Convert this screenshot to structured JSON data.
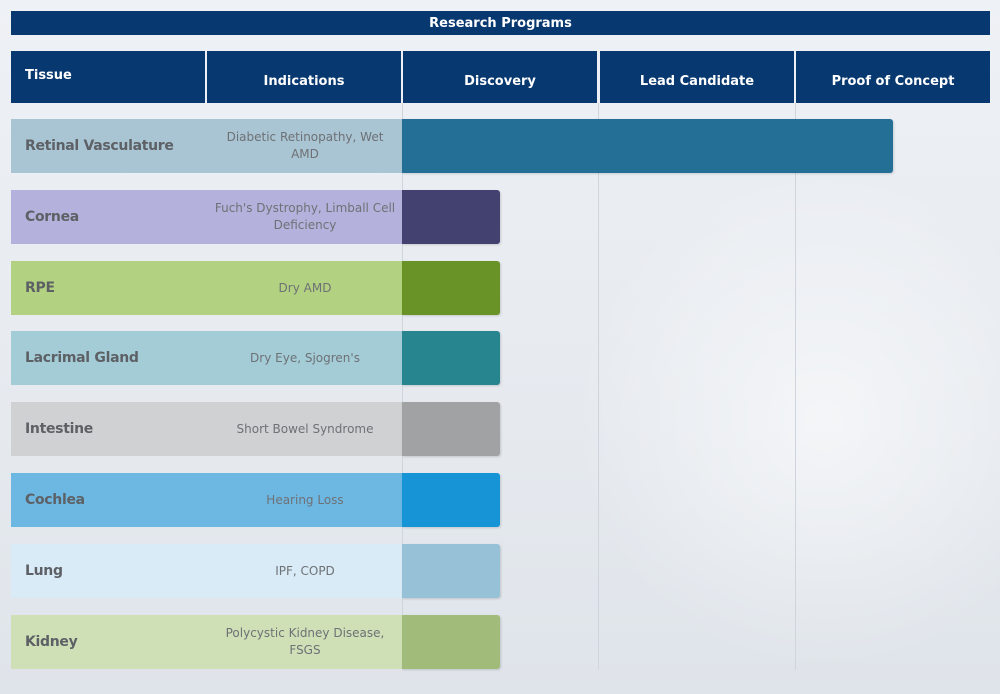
{
  "title": "Research Programs",
  "columns": [
    "Tissue",
    "Indications",
    "Discovery",
    "Lead Candidate",
    "Proof of Concept"
  ],
  "chart_data": {
    "type": "bar",
    "orientation": "horizontal",
    "title": "Research Programs",
    "stages": [
      "Discovery",
      "Lead Candidate",
      "Proof of Concept"
    ],
    "xlim": [
      0,
      3
    ],
    "rows": [
      {
        "tissue": "Retinal Vasculature",
        "indication": "Diabetic Retinopathy, Wet AMD",
        "progress": 2.5,
        "label_color": "#a9c4d2",
        "bar_color": "#236f95"
      },
      {
        "tissue": "Cornea",
        "indication": "Fuch's Dystrophy, Limball Cell Deficiency",
        "progress": 0.5,
        "label_color": "#b4b2dc",
        "bar_color": "#434170"
      },
      {
        "tissue": "RPE",
        "indication": "Dry AMD",
        "progress": 0.5,
        "label_color": "#b2d281",
        "bar_color": "#6a9327"
      },
      {
        "tissue": "Lacrimal Gland",
        "indication": "Dry Eye, Sjogren's",
        "progress": 0.5,
        "label_color": "#a4ccd7",
        "bar_color": "#27858f"
      },
      {
        "tissue": "Intestine",
        "indication": "Short Bowel Syndrome",
        "progress": 0.5,
        "label_color": "#d0d1d3",
        "bar_color": "#a1a2a4"
      },
      {
        "tissue": "Cochlea",
        "indication": "Hearing Loss",
        "progress": 0.5,
        "label_color": "#6db8e2",
        "bar_color": "#1794d6"
      },
      {
        "tissue": "Lung",
        "indication": "IPF, COPD",
        "progress": 0.5,
        "label_color": "#d9ebf6",
        "bar_color": "#96c1d7"
      },
      {
        "tissue": "Kidney",
        "indication": "Polycystic Kidney Disease, FSGS",
        "progress": 0.5,
        "label_color": "#cfe0b7",
        "bar_color": "#a0bb7a"
      }
    ]
  }
}
